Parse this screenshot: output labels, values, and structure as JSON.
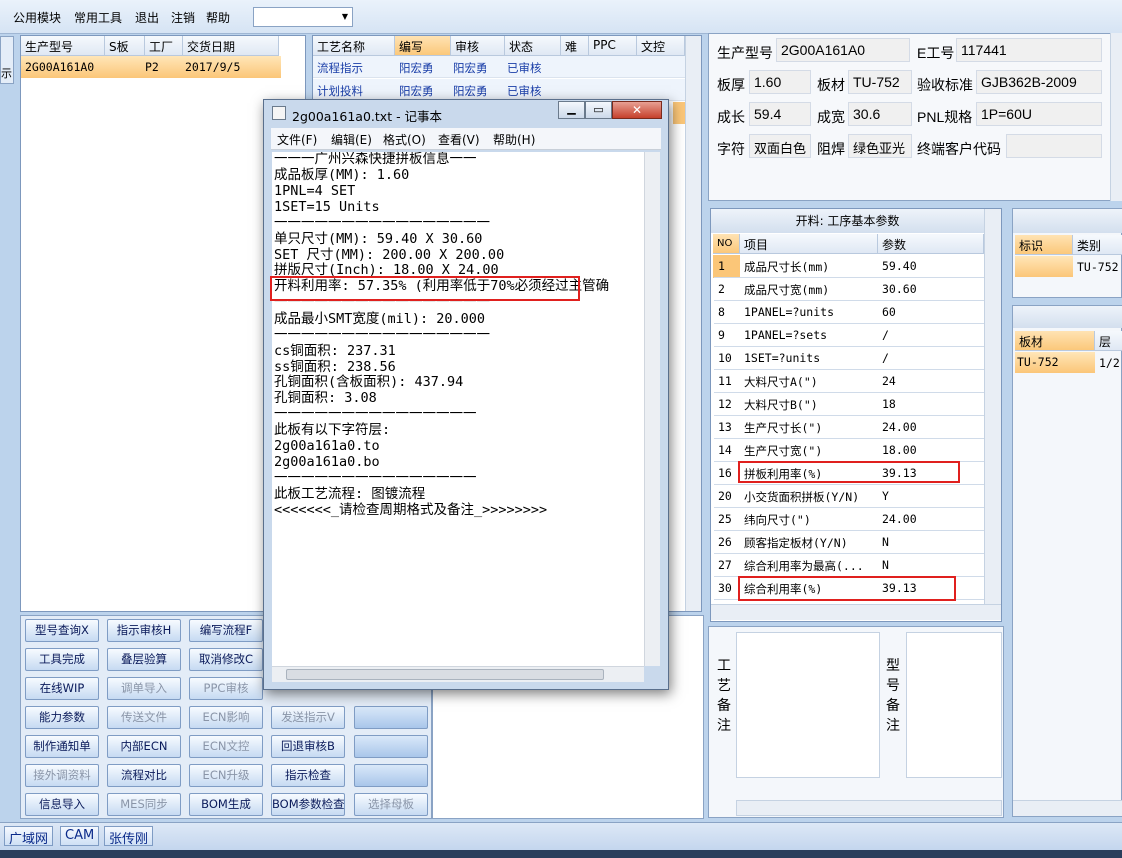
{
  "menubar": {
    "items": [
      "公用模块",
      "常用工具",
      "退出",
      "注销",
      "帮助"
    ],
    "combo_value": ""
  },
  "left_strip_text": "示",
  "order_grid": {
    "columns": [
      "生产型号",
      "S板",
      "工厂",
      "交货日期"
    ],
    "rows": [
      {
        "model": "2G00A161A0",
        "s": "",
        "factory": "P2",
        "date": "2017/9/5"
      }
    ]
  },
  "process_grid": {
    "columns": [
      "工艺名称",
      "编写",
      "审核",
      "状态",
      "难",
      "PPC",
      "文控"
    ],
    "rows": [
      {
        "name": "流程指示",
        "writer": "阳宏勇",
        "reviewer": "阳宏勇",
        "status": "已审核"
      },
      {
        "name": "计划投料",
        "writer": "阳宏勇",
        "reviewer": "阳宏勇",
        "status": "已审核"
      }
    ]
  },
  "buttons": [
    [
      "型号查询X",
      "指示审核H",
      "编写流程F",
      ""
    ],
    [
      "工具完成",
      "叠层验算",
      "取消修改C",
      ""
    ],
    [
      "在线WIP",
      "调单导入",
      "PPC审核",
      ""
    ],
    [
      "能力参数",
      "传送文件",
      "ECN影响",
      "发送指示V",
      ""
    ],
    [
      "制作通知单",
      "内部ECN",
      "ECN文控",
      "回退审核B",
      ""
    ],
    [
      "接外调资料",
      "流程对比",
      "ECN升级",
      "指示检查",
      ""
    ],
    [
      "信息导入",
      "MES同步",
      "BOM生成",
      "BOM参数检查",
      "选择母板"
    ]
  ],
  "info": {
    "model_label": "生产型号",
    "model": "2G00A161A0",
    "e_label": "E工号",
    "e_value": "117441",
    "thick_label": "板厚",
    "thick": "1.60",
    "mat_label": "板材",
    "mat": "TU-752",
    "std_label": "验收标准",
    "std": "GJB362B-2009",
    "len_label": "成长",
    "len": "59.4",
    "wid_label": "成宽",
    "wid": "30.6",
    "pnl_label": "PNL规格",
    "pnl": "1P=60U",
    "char_label": "字符",
    "char": "双面白色",
    "mask_label": "阻焊",
    "mask": "绿色亚光",
    "cust_label": "终端客户代码",
    "cust": ""
  },
  "params": {
    "title": "开料: 工序基本参数",
    "columns": [
      "NO",
      "项目",
      "参数"
    ],
    "rows": [
      {
        "no": "1",
        "item": "成品尺寸长(mm)",
        "val": "59.40"
      },
      {
        "no": "2",
        "item": "成品尺寸宽(mm)",
        "val": "30.60"
      },
      {
        "no": "8",
        "item": "1PANEL=?units",
        "val": "60"
      },
      {
        "no": "9",
        "item": "1PANEL=?sets",
        "val": "/"
      },
      {
        "no": "10",
        "item": "1SET=?units",
        "val": "/"
      },
      {
        "no": "11",
        "item": "大料尺寸A(\")",
        "val": "24"
      },
      {
        "no": "12",
        "item": "大料尺寸B(\")",
        "val": "18"
      },
      {
        "no": "13",
        "item": "生产尺寸长(\")",
        "val": "24.00"
      },
      {
        "no": "14",
        "item": "生产尺寸宽(\")",
        "val": "18.00"
      },
      {
        "no": "16",
        "item": "拼板利用率(%)",
        "val": "39.13"
      },
      {
        "no": "20",
        "item": "小交货面积拼板(Y/N)",
        "val": "Y"
      },
      {
        "no": "25",
        "item": "纬向尺寸(\")",
        "val": "24.00"
      },
      {
        "no": "26",
        "item": "顾客指定板材(Y/N)",
        "val": "N"
      },
      {
        "no": "27",
        "item": "综合利用率为最高(...",
        "val": "N"
      },
      {
        "no": "30",
        "item": "综合利用率(%)",
        "val": "39.13"
      }
    ]
  },
  "right_grid1": {
    "columns": [
      "标识",
      "类别"
    ],
    "row": [
      "",
      "TU-752"
    ]
  },
  "right_grid2": {
    "columns": [
      "板材",
      "层"
    ],
    "row": [
      "TU-752",
      "1/2"
    ]
  },
  "notes": {
    "craft_label": [
      "工",
      "艺",
      "备",
      "注"
    ],
    "model_label": [
      "型",
      "号",
      "备",
      "注"
    ]
  },
  "taskbar": [
    "广域网",
    "CAM",
    "张传刚"
  ],
  "notepad": {
    "title": "2g00a161a0.txt - 记事本",
    "menu": [
      "文件(F)",
      "编辑(E)",
      "格式(O)",
      "查看(V)",
      "帮助(H)"
    ],
    "lines": [
      "一一一广州兴森快捷拼板信息一一",
      "成品板厚(MM): 1.60",
      "1PNL=4 SET",
      "1SET=15 Units",
      "一一一一一一一一一一一一一一一一",
      "单只尺寸(MM): 59.40 X 30.60",
      "SET 尺寸(MM): 200.00 X 200.00",
      "拼版尺寸(Inch): 18.00 X 24.00",
      "开料利用率: 57.35% (利用率低于70%必须经过主管确",
      "一一一一一一一一一一一一一一一一",
      "成品最小SMT宽度(mil): 20.000",
      "一一一一一一一一一一一一一一一一",
      "cs铜面积: 237.31",
      "ss铜面积: 238.56",
      "孔铜面积(含板面积): 437.94",
      "孔铜面积: 3.08",
      "一一一一一一一一一一一一一一一",
      "此板有以下字符层:",
      "2g00a161a0.to",
      "2g00a161a0.bo",
      "一一一一一一一一一一一一一一一",
      "此板工艺流程: 图镀流程",
      "<<<<<<<_请检查周期格式及备注_>>>>>>>>"
    ]
  }
}
